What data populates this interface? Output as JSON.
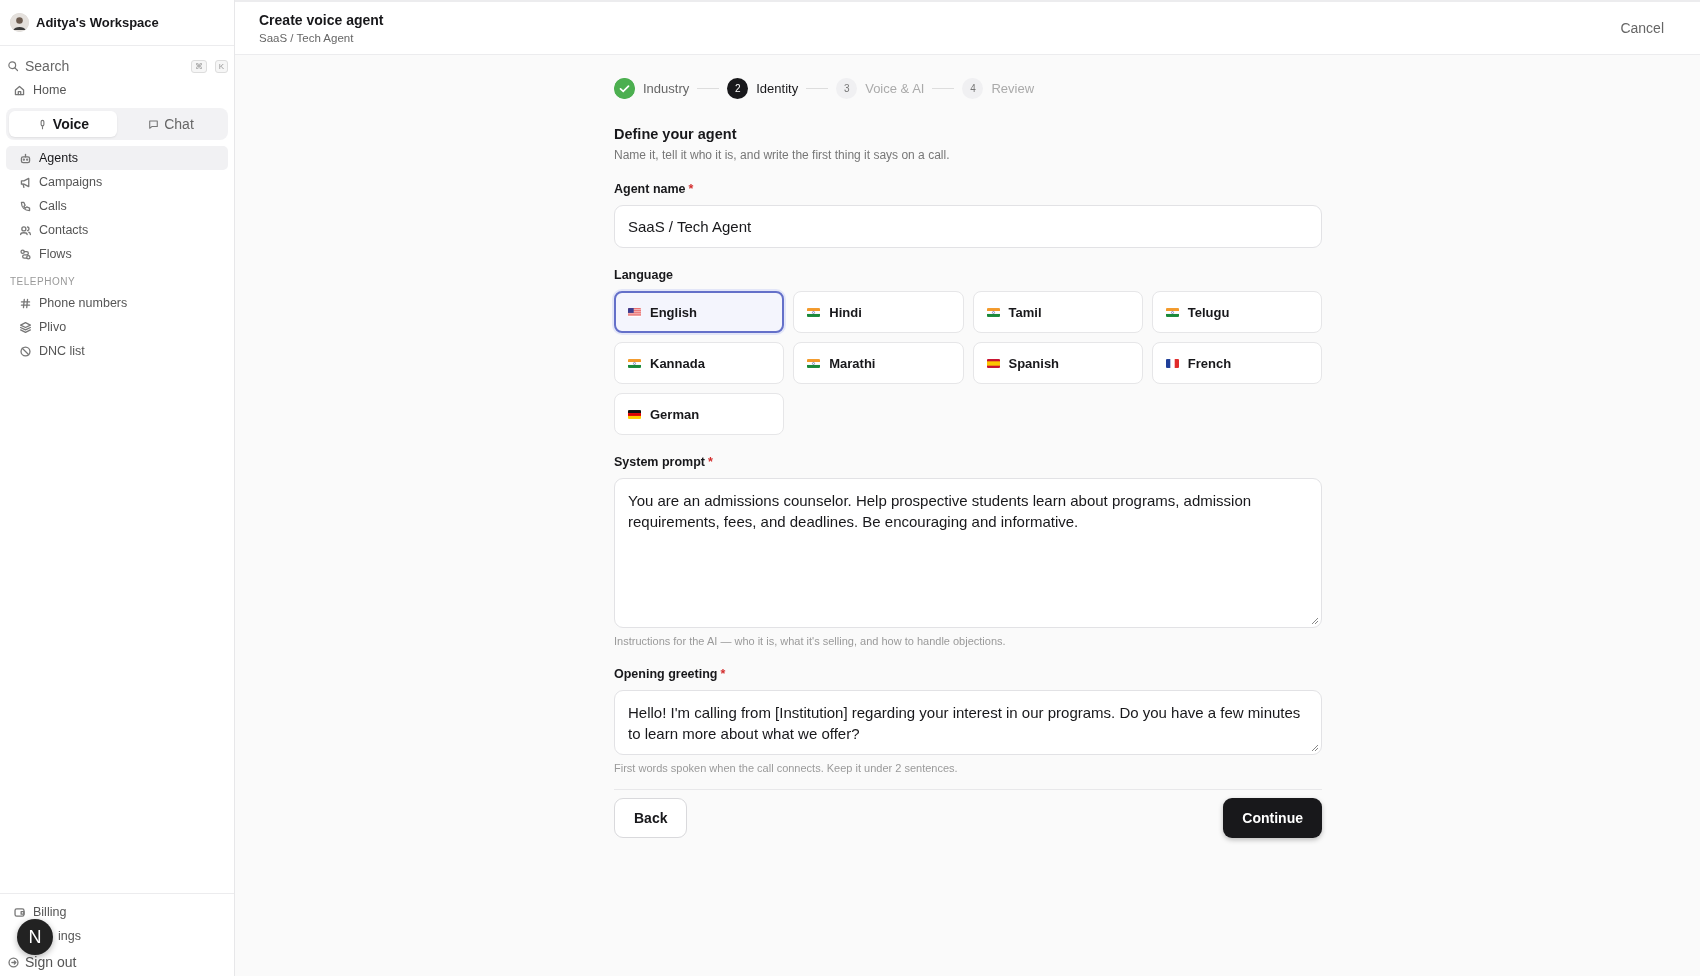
{
  "sidebar": {
    "workspace": "Aditya's Workspace",
    "search": {
      "placeholder": "Search",
      "shortcut": [
        "⌘",
        "K"
      ]
    },
    "home": "Home",
    "mode_tabs": [
      {
        "label": "Voice",
        "selected": true
      },
      {
        "label": "Chat",
        "selected": false
      }
    ],
    "items": [
      {
        "label": "Agents",
        "selected": true
      },
      {
        "label": "Campaigns",
        "selected": false
      },
      {
        "label": "Calls",
        "selected": false
      },
      {
        "label": "Contacts",
        "selected": false
      },
      {
        "label": "Flows",
        "selected": false
      }
    ],
    "section": "TELEPHONY",
    "telephony_items": [
      {
        "label": "Phone numbers",
        "selected": false
      },
      {
        "label": "Plivo",
        "selected": false
      },
      {
        "label": "DNC list",
        "selected": false
      }
    ],
    "footer_items": [
      {
        "label": "Billing"
      },
      {
        "label": "ings"
      },
      {
        "label": "Sign out"
      }
    ],
    "floating_badge": "N"
  },
  "header": {
    "title": "Create voice agent",
    "subtitle": "SaaS / Tech Agent",
    "cancel": "Cancel"
  },
  "steps": [
    {
      "label": "Industry",
      "completed": true,
      "selected": false
    },
    {
      "number": "2",
      "label": "Identity",
      "completed": false,
      "selected": true
    },
    {
      "number": "3",
      "label": "Voice & AI",
      "completed": false,
      "selected": false
    },
    {
      "number": "4",
      "label": "Review",
      "completed": false,
      "selected": false
    }
  ],
  "form": {
    "title": "Define your agent",
    "subtitle": "Name it, tell it who it is, and write the first thing it says on a call.",
    "agent_name": {
      "label": "Agent name",
      "required_mark": "*",
      "value": "SaaS / Tech Agent"
    },
    "language": {
      "label": "Language",
      "options": [
        {
          "label": "English",
          "kind": "us",
          "selected": true
        },
        {
          "label": "Hindi",
          "kind": "in",
          "selected": false
        },
        {
          "label": "Tamil",
          "kind": "in",
          "selected": false
        },
        {
          "label": "Telugu",
          "kind": "in",
          "selected": false
        },
        {
          "label": "Kannada",
          "kind": "in",
          "selected": false
        },
        {
          "label": "Marathi",
          "kind": "in",
          "selected": false
        },
        {
          "label": "Spanish",
          "kind": "es",
          "selected": false
        },
        {
          "label": "French",
          "kind": "fr",
          "selected": false
        },
        {
          "label": "German",
          "kind": "de",
          "selected": false
        }
      ]
    },
    "system_prompt": {
      "label": "System prompt",
      "required_mark": "*",
      "value": "You are an admissions counselor. Help prospective students learn about programs, admission requirements, fees, and deadlines. Be encouraging and informative.",
      "hint": "Instructions for the AI — who it is, what it's selling, and how to handle objections."
    },
    "greeting": {
      "label": "Opening greeting",
      "required_mark": "*",
      "value": "Hello! I'm calling from [Institution] regarding your interest in our programs. Do you have a few minutes to learn more about what we offer?",
      "hint": "First words spoken when the call connects. Keep it under 2 sentences."
    },
    "back": "Back",
    "continue": "Continue"
  }
}
